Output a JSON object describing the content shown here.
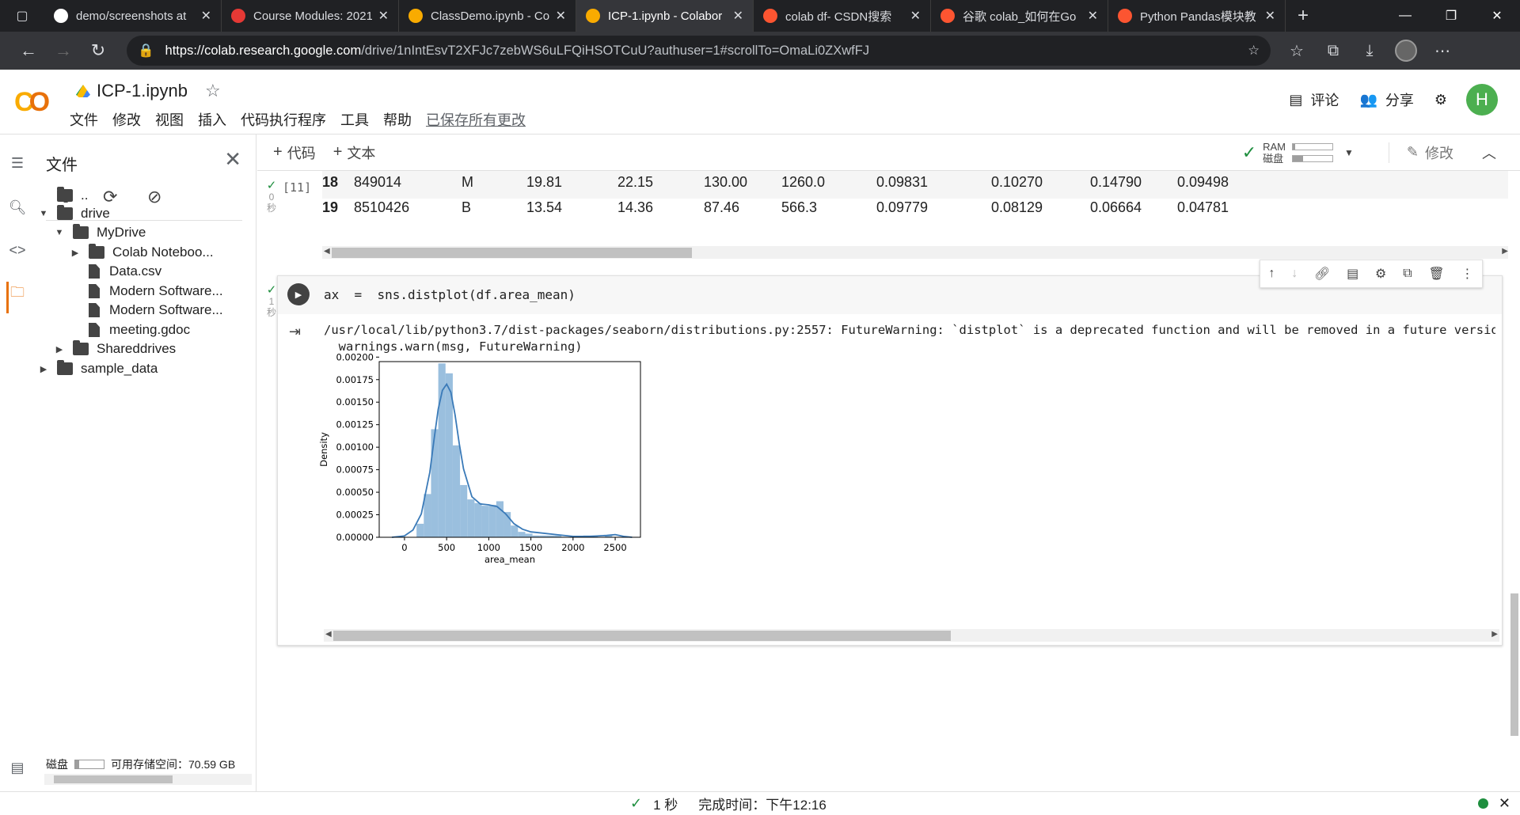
{
  "browser": {
    "tabs": [
      {
        "title": "demo/screenshots at",
        "icon": "github-icon",
        "color": "#ffffff"
      },
      {
        "title": "Course Modules: 2021",
        "icon": "course-icon",
        "color": "#e53935"
      },
      {
        "title": "ClassDemo.ipynb - Co",
        "icon": "colab-icon",
        "color": "#f9ab00"
      },
      {
        "title": "ICP-1.ipynb - Colabor",
        "icon": "colab-icon",
        "color": "#f9ab00",
        "active": true
      },
      {
        "title": "colab df- CSDN搜索",
        "icon": "csdn-icon",
        "color": "#fc5531"
      },
      {
        "title": "谷歌 colab_如何在Go",
        "icon": "csdn-icon",
        "color": "#fc5531"
      },
      {
        "title": "Python Pandas模块教",
        "icon": "csdn-icon",
        "color": "#fc5531"
      }
    ],
    "url_host": "https://colab.research.google.com",
    "url_path": "/drive/1nIntEsvT2XFJc7zebWS6uLFQiHSOTCuU?authuser=1#scrollTo=OmaLi0ZXwfFJ"
  },
  "header": {
    "logo": "CO",
    "notebook_title": "ICP-1.ipynb",
    "menu": [
      "文件",
      "修改",
      "视图",
      "插入",
      "代码执行程序",
      "工具",
      "帮助"
    ],
    "saved_status": "已保存所有更改",
    "comment_label": "评论",
    "share_label": "分享",
    "user_initial": "H"
  },
  "file_panel": {
    "title": "文件",
    "tree": [
      {
        "label": "..",
        "type": "up",
        "depth": 0
      },
      {
        "label": "drive",
        "type": "folder",
        "depth": 0,
        "expanded": true
      },
      {
        "label": "MyDrive",
        "type": "folder",
        "depth": 1,
        "expanded": true
      },
      {
        "label": "Colab Noteboo...",
        "type": "folder",
        "depth": 2,
        "expanded": false
      },
      {
        "label": "Data.csv",
        "type": "file",
        "depth": 2
      },
      {
        "label": "Modern Software...",
        "type": "file",
        "depth": 2
      },
      {
        "label": "Modern Software...",
        "type": "file",
        "depth": 2
      },
      {
        "label": "meeting.gdoc",
        "type": "file",
        "depth": 2
      },
      {
        "label": "Shareddrives",
        "type": "folder",
        "depth": 1,
        "expanded": false
      },
      {
        "label": "sample_data",
        "type": "folder",
        "depth": 0,
        "expanded": false
      }
    ],
    "disk_label": "磁盘",
    "disk_used_fraction": 0.15,
    "disk_free": "可用存储空间：70.59 GB"
  },
  "toolbar": {
    "add_code": "代码",
    "add_text": "文本",
    "ram_label": "RAM",
    "disk_label": "磁盘",
    "ram_fraction": 0.05,
    "disk_fraction": 0.25,
    "edit_label": "修改"
  },
  "cell11": {
    "exec_count": "[11]",
    "exec_time": "0\n秒",
    "rows": [
      [
        "18",
        "849014",
        "M",
        "19.81",
        "22.15",
        "130.00",
        "1260.0",
        "0.09831",
        "0.10270",
        "0.14790",
        "0.09498"
      ],
      [
        "19",
        "8510426",
        "B",
        "13.54",
        "14.36",
        "87.46",
        "566.3",
        "0.09779",
        "0.08129",
        "0.06664",
        "0.04781"
      ]
    ]
  },
  "cell2": {
    "exec_time": "1\n秒",
    "code_var": "ax",
    "code_op": "=",
    "code_expr": "sns.distplot(df.area_mean)",
    "warning_line1": "/usr/local/lib/python3.7/dist-packages/seaborn/distributions.py:2557: FutureWarning: `distplot` is a deprecated function and will be removed in a future version. Plea",
    "warning_line2": "  warnings.warn(msg, FutureWarning)"
  },
  "chart_data": {
    "type": "bar",
    "title": "",
    "xlabel": "area_mean",
    "ylabel": "Density",
    "xlim": [
      -300,
      2800
    ],
    "ylim": [
      0,
      0.00195
    ],
    "xticks": [
      0,
      500,
      1000,
      1500,
      2000,
      2500
    ],
    "xtick_labels": [
      "0",
      "500",
      "1000",
      "1500",
      "2000",
      "2500"
    ],
    "yticks": [
      0,
      0.00025,
      0.0005,
      0.00075,
      0.001,
      0.00125,
      0.0015,
      0.00175,
      0.002
    ],
    "ytick_labels": [
      "0.00000",
      "0.00025",
      "0.00050",
      "0.00075",
      "0.00100",
      "0.00125",
      "0.00150",
      "0.00175",
      "0.00200"
    ],
    "bin_edges": [
      143,
      229,
      315,
      401,
      487,
      573,
      659,
      745,
      831,
      917,
      1003,
      1089,
      1175,
      1261,
      1347,
      1433,
      1519,
      1605,
      1691,
      1777,
      1863,
      1949,
      2035,
      2121,
      2207,
      2293,
      2379,
      2465,
      2551
    ],
    "bar_color": "#8fb8da",
    "series": [
      {
        "values": [
          0.00015,
          0.00048,
          0.0012,
          0.00193,
          0.00182,
          0.00102,
          0.00058,
          0.00042,
          0.00038,
          0.00035,
          0.00036,
          0.0004,
          0.00028,
          0.00013,
          6e-05,
          4e-05,
          2e-05,
          2e-05,
          2e-05,
          2e-05,
          0,
          0,
          0,
          2e-05,
          2e-05,
          0,
          2e-05,
          0,
          0
        ]
      },
      {
        "type": "line",
        "color": "#3a7ab8",
        "x": [
          -150,
          0,
          100,
          200,
          300,
          350,
          400,
          450,
          500,
          550,
          600,
          650,
          700,
          800,
          900,
          1000,
          1100,
          1200,
          1300,
          1400,
          1500,
          1600,
          1800,
          2000,
          2200,
          2400,
          2500,
          2600,
          2700
        ],
        "y": [
          0.0,
          1.5e-05,
          8e-05,
          0.00026,
          0.00072,
          0.00108,
          0.00142,
          0.00163,
          0.0017,
          0.00161,
          0.00136,
          0.00104,
          0.00076,
          0.00045,
          0.00037,
          0.00036,
          0.00034,
          0.00026,
          0.00015,
          9e-05,
          6e-05,
          5e-05,
          3e-05,
          1e-05,
          1e-05,
          2e-05,
          3e-05,
          1e-05,
          0.0
        ]
      }
    ]
  },
  "status": {
    "duration": "1 秒",
    "completed": "完成时间：下午12:16"
  }
}
